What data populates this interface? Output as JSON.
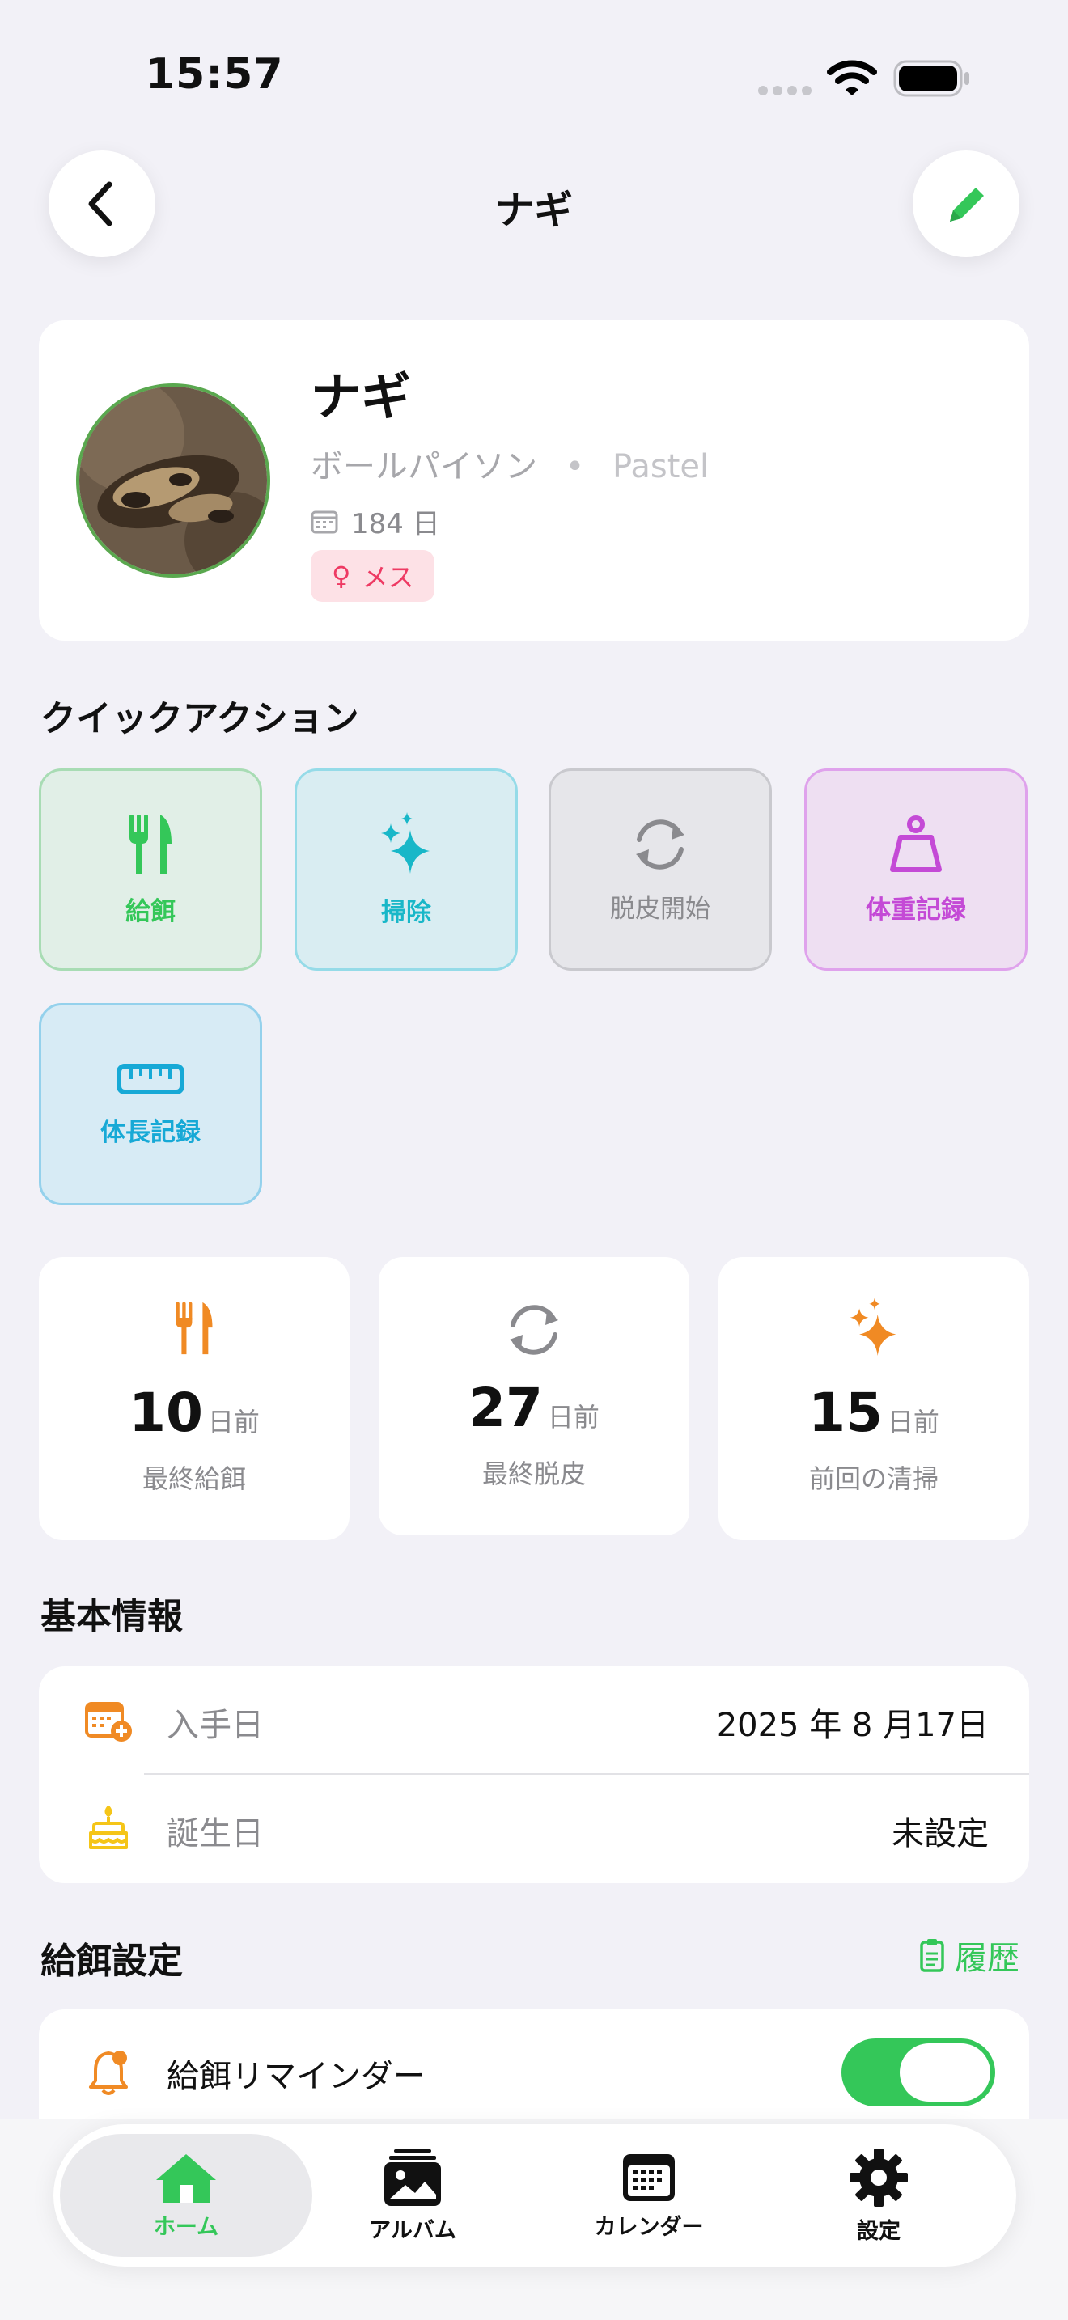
{
  "status": {
    "time": "15:57"
  },
  "nav": {
    "title": "ナギ"
  },
  "profile": {
    "name": "ナギ",
    "species": "ボールパイソン",
    "separator": "•",
    "morph": "Pastel",
    "days": "184 日",
    "sex_symbol": "♀",
    "sex": "メス"
  },
  "quick_actions": {
    "title": "クイックアクション",
    "items": [
      {
        "label": "給餌",
        "icon": "fork-knife-icon",
        "color": "#34c759"
      },
      {
        "label": "掃除",
        "icon": "sparkles-icon",
        "color": "#18b7c8"
      },
      {
        "label": "脱皮開始",
        "icon": "cycle-icon",
        "color": "#8a8a8e"
      },
      {
        "label": "体重記録",
        "icon": "scale-icon",
        "color": "#c44ad6"
      },
      {
        "label": "体長記録",
        "icon": "ruler-icon",
        "color": "#17a9d6"
      }
    ]
  },
  "stats": [
    {
      "value": "10",
      "unit": "日前",
      "caption": "最終給餌",
      "color": "#f08a24"
    },
    {
      "value": "27",
      "unit": "日前",
      "caption": "最終脱皮",
      "color": "#8a8a8e"
    },
    {
      "value": "15",
      "unit": "日前",
      "caption": "前回の清掃",
      "color": "#f08a24"
    }
  ],
  "basic_info": {
    "title": "基本情報",
    "rows": [
      {
        "label": "入手日",
        "value": "2025 年 8 月17日"
      },
      {
        "label": "誕生日",
        "value": "未設定"
      }
    ]
  },
  "feeding": {
    "title": "給餌設定",
    "history_label": "履歴",
    "reminder_label": "給餌リマインダー",
    "reminder_on": true
  },
  "tabs": [
    {
      "label": "ホーム",
      "active": true
    },
    {
      "label": "アルバム",
      "active": false
    },
    {
      "label": "カレンダー",
      "active": false
    },
    {
      "label": "設定",
      "active": false
    }
  ]
}
